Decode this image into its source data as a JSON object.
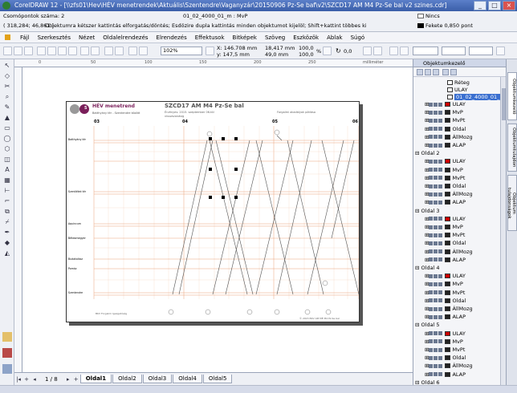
{
  "window": {
    "title": "CorelDRAW 12 - [\\\\zfs01\\Hev\\HÉV menetrendek\\Aktuális\\Szentendre\\Vaganyzár\\20150906 Pz-Se baf\\v2\\SZCD17 AM M4 Pz-Se bal v2 szines.cdr]",
    "minimize": "_",
    "maximize": "□",
    "close": "×"
  },
  "status": {
    "object_count": "Csomópontok száma: 2",
    "cursor_pos": "( 318,284; 46,861 )",
    "hint": "Objektumra kétszer kattintás elforgatás/döntés; Esdözire dupla kattintás minden objektumot kijelöl; Shift+kattint többes kijelölés; Alt+kattintás ás...",
    "layer_info": "01_02_4000_01_m : MvP",
    "fill": "Nincs",
    "outline": "Fekete  0,850 pont"
  },
  "menu": [
    "Fájl",
    "Szerkesztés",
    "Nézet",
    "Oldalelrendezés",
    "Elrendezés",
    "Effektusok",
    "Bitképek",
    "Szöveg",
    "Eszközök",
    "Ablak",
    "Súgó"
  ],
  "toolbar": {
    "zoom": "102%",
    "x": "X: 146.708 mm",
    "y": "y: 147,5 mm",
    "w": "18,417 mm",
    "h": "49,0 mm",
    "sx": "100,0",
    "sy": "100,0",
    "pct": "%",
    "angle": "0,0",
    "ruler_unit": "milliméter"
  },
  "canvas": {
    "doc_title": "SZCD17 AM M4 Pz-Se bal",
    "brand": "HÉV menetrend",
    "line_badge": "5",
    "route": "Batthyány tér - Szentendre között",
    "validity": "Érvényes: 2015. szeptember 06-tól",
    "validity2": "visszavonásig",
    "note": "Forgalmi akadályok pótlása",
    "hours": [
      "03",
      "04",
      "05",
      "06"
    ],
    "stations": [
      "Batthyány tér",
      "Szentlélek tér",
      "Aquincum",
      "Békásmegyer",
      "Budakalász",
      "Pomáz",
      "Szentendre"
    ],
    "footer_left": "BKV Forgalmi Igazgatóság",
    "footer_right": "© 2015 BKV AM MÉ M4 Pz-Se bal"
  },
  "pages": {
    "counter": "1 / 8",
    "tabs": [
      "Oldal1",
      "Oldal2",
      "Oldal3",
      "Oldal4",
      "Oldal5"
    ]
  },
  "docker": {
    "title": "Objektumkezelő",
    "layers": [
      {
        "kind": "sub",
        "name": "Réteg",
        "color": "#ffffff"
      },
      {
        "kind": "sub",
        "name": "ULAY",
        "color": "#ffffff"
      },
      {
        "kind": "sel",
        "name": "01_02_4000_01_",
        "color": "#ffffff"
      },
      {
        "kind": "row",
        "name": "ULAY",
        "color": "#cc0000"
      },
      {
        "kind": "row",
        "name": "MvP",
        "color": "#222222"
      },
      {
        "kind": "row",
        "name": "MvPt",
        "color": "#222222"
      },
      {
        "kind": "row",
        "name": "Oldal",
        "color": "#222222"
      },
      {
        "kind": "row",
        "name": "ÁllMozg",
        "color": "#222222"
      },
      {
        "kind": "row",
        "name": "ALAP",
        "color": "#222222"
      },
      {
        "kind": "page",
        "name": "Oldal 2"
      },
      {
        "kind": "row",
        "name": "ULAY",
        "color": "#cc0000"
      },
      {
        "kind": "row",
        "name": "MvP",
        "color": "#222222"
      },
      {
        "kind": "row",
        "name": "MvPt",
        "color": "#222222"
      },
      {
        "kind": "row",
        "name": "Oldal",
        "color": "#222222"
      },
      {
        "kind": "row",
        "name": "ÁllMozg",
        "color": "#222222"
      },
      {
        "kind": "row",
        "name": "ALAP",
        "color": "#222222"
      },
      {
        "kind": "page",
        "name": "Oldal 3"
      },
      {
        "kind": "row",
        "name": "ULAY",
        "color": "#cc0000"
      },
      {
        "kind": "row",
        "name": "MvP",
        "color": "#222222"
      },
      {
        "kind": "row",
        "name": "MvPt",
        "color": "#222222"
      },
      {
        "kind": "row",
        "name": "Oldal",
        "color": "#222222"
      },
      {
        "kind": "row",
        "name": "ÁllMozg",
        "color": "#222222"
      },
      {
        "kind": "row",
        "name": "ALAP",
        "color": "#222222"
      },
      {
        "kind": "page",
        "name": "Oldal 4"
      },
      {
        "kind": "row",
        "name": "ULAY",
        "color": "#cc0000"
      },
      {
        "kind": "row",
        "name": "MvP",
        "color": "#222222"
      },
      {
        "kind": "row",
        "name": "MvPt",
        "color": "#222222"
      },
      {
        "kind": "row",
        "name": "Oldal",
        "color": "#222222"
      },
      {
        "kind": "row",
        "name": "ÁllMozg",
        "color": "#222222"
      },
      {
        "kind": "row",
        "name": "ALAP",
        "color": "#222222"
      },
      {
        "kind": "page",
        "name": "Oldal 5"
      },
      {
        "kind": "row",
        "name": "ULAY",
        "color": "#cc0000"
      },
      {
        "kind": "row",
        "name": "MvP",
        "color": "#222222"
      },
      {
        "kind": "row",
        "name": "MvPt",
        "color": "#222222"
      },
      {
        "kind": "row",
        "name": "Oldal",
        "color": "#222222"
      },
      {
        "kind": "row",
        "name": "ÁllMozg",
        "color": "#222222"
      },
      {
        "kind": "row",
        "name": "ALAP",
        "color": "#222222"
      },
      {
        "kind": "page",
        "name": "Oldal 6"
      },
      {
        "kind": "row",
        "name": "ULAY",
        "color": "#cc0000"
      },
      {
        "kind": "row",
        "name": "MvP",
        "color": "#222222"
      }
    ]
  },
  "sidetabs": [
    "Objektumkezelő",
    "Objektumtulajdon",
    "Objektum tulajdonságok"
  ]
}
